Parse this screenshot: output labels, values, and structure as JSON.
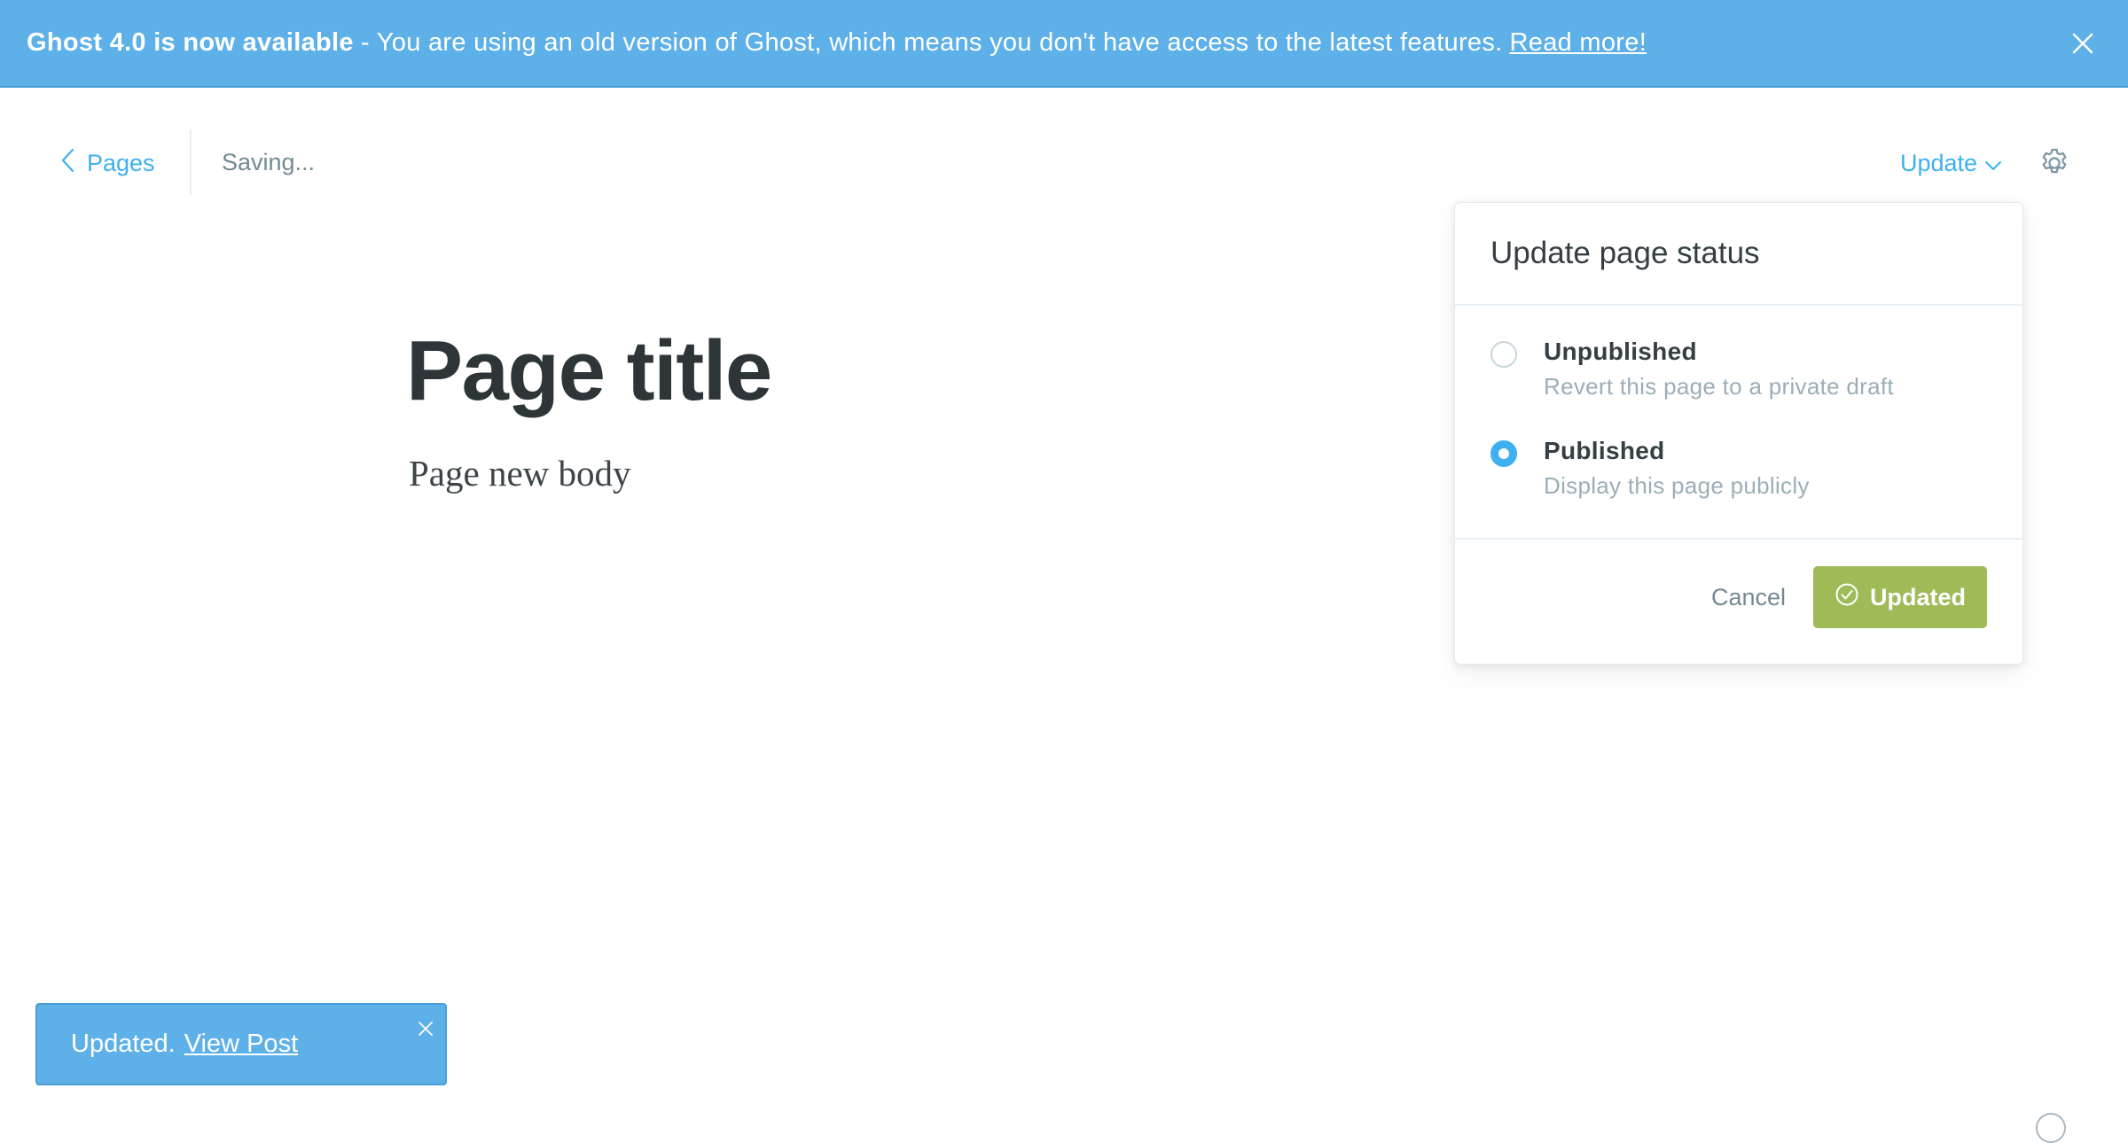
{
  "banner": {
    "title": "Ghost 4.0 is now available",
    "separator": "-",
    "message": "You are using an old version of Ghost, which means you don't have access to the latest features.",
    "link_text": "Read more!",
    "close_icon": "close-icon"
  },
  "header": {
    "back_label": "Pages",
    "back_icon": "chevron-left-icon",
    "status": "Saving...",
    "update_label": "Update",
    "update_icon": "chevron-down-icon",
    "settings_icon": "gear-icon"
  },
  "editor": {
    "title": "Page title",
    "body": "Page new body"
  },
  "publish_menu": {
    "heading": "Update page status",
    "options": [
      {
        "label": "Unpublished",
        "description": "Revert this page to a private draft",
        "selected": false
      },
      {
        "label": "Published",
        "description": "Display this page publicly",
        "selected": true
      }
    ],
    "cancel_label": "Cancel",
    "confirm_label": "Updated",
    "confirm_icon": "check-circle-icon"
  },
  "toast": {
    "message": "Updated.",
    "link_text": "View Post",
    "close_icon": "close-icon"
  },
  "colors": {
    "accent_blue": "#3eb0ef",
    "banner_blue": "#5eb0e8",
    "success_green": "#9fbb58"
  }
}
